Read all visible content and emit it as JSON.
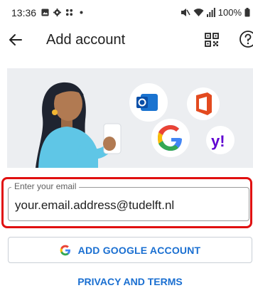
{
  "status_bar": {
    "time": "13:36",
    "battery_text": "100%",
    "icons_left": [
      "gallery-icon",
      "settings-icon",
      "apps-icon",
      "dot-icon"
    ],
    "icons_right": [
      "mute-icon",
      "wifi-icon",
      "signal-icon",
      "battery-icon"
    ]
  },
  "app_bar": {
    "title": "Add account",
    "back_icon": "arrow-left-icon",
    "qr_icon": "qr-code-icon",
    "help_icon": "question-circle-icon"
  },
  "hero": {
    "illustration": "person-holding-phone",
    "logos": [
      "outlook-logo",
      "office-logo",
      "google-logo",
      "yahoo-logo"
    ]
  },
  "email": {
    "label": "Enter your email",
    "value": "your.email.address@tudelft.nl"
  },
  "google_button": {
    "label": "ADD GOOGLE ACCOUNT",
    "icon": "google-g-icon"
  },
  "privacy": {
    "label": "PRIVACY AND TERMS"
  },
  "colors": {
    "accent": "#1a6fd1",
    "highlight": "#e01010",
    "hero_bg": "#eceef1"
  }
}
